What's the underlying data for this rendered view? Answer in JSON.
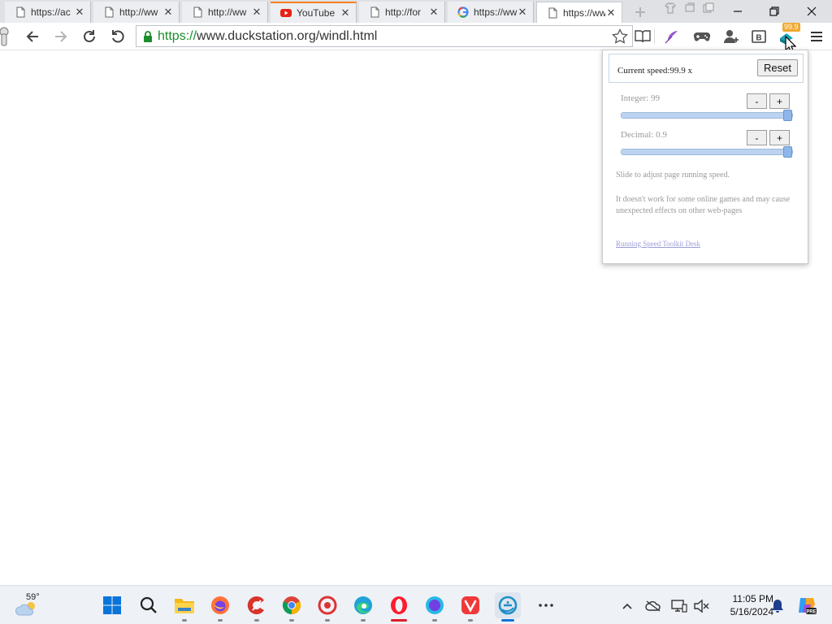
{
  "tabs": [
    {
      "title": "https://ac",
      "icon": "page-icon"
    },
    {
      "title": "http://ww",
      "icon": "page-icon"
    },
    {
      "title": "http://ww",
      "icon": "page-icon"
    },
    {
      "title": "YouTube",
      "icon": "youtube-icon"
    },
    {
      "title": "http://for",
      "icon": "page-icon"
    },
    {
      "title": "https://ww",
      "icon": "google-icon"
    },
    {
      "title": "https://ww",
      "icon": "page-icon",
      "active": true
    }
  ],
  "tab_close_glyph": "✕",
  "address": {
    "scheme": "https://",
    "rest": "www.duckstation.org/windl.html"
  },
  "extension_badge": "99.9",
  "speed_popup": {
    "current_speed_label": "Current speed:",
    "current_speed_value": "99.9 x",
    "reset_label": "Reset",
    "integer_label": "Integer: 99",
    "decimal_label": "Decimal: 0.9",
    "minus_label": "-",
    "plus_label": "+",
    "integer_level": 1.0,
    "decimal_level": 1.0,
    "note1": "Slide to adjust page running speed.",
    "note2": "It doesn't work for some online games and may cause unexpected effects on other web-pages",
    "credit_link": "Running Speed Toolkit Desk"
  },
  "taskbar": {
    "weather_temp": "59°",
    "time": "11:05 PM",
    "date": "5/16/2024"
  },
  "colors": {
    "secure_green": "#1b8d2c",
    "youtube_red": "#e62117",
    "windows_blue": "#0a74da"
  }
}
